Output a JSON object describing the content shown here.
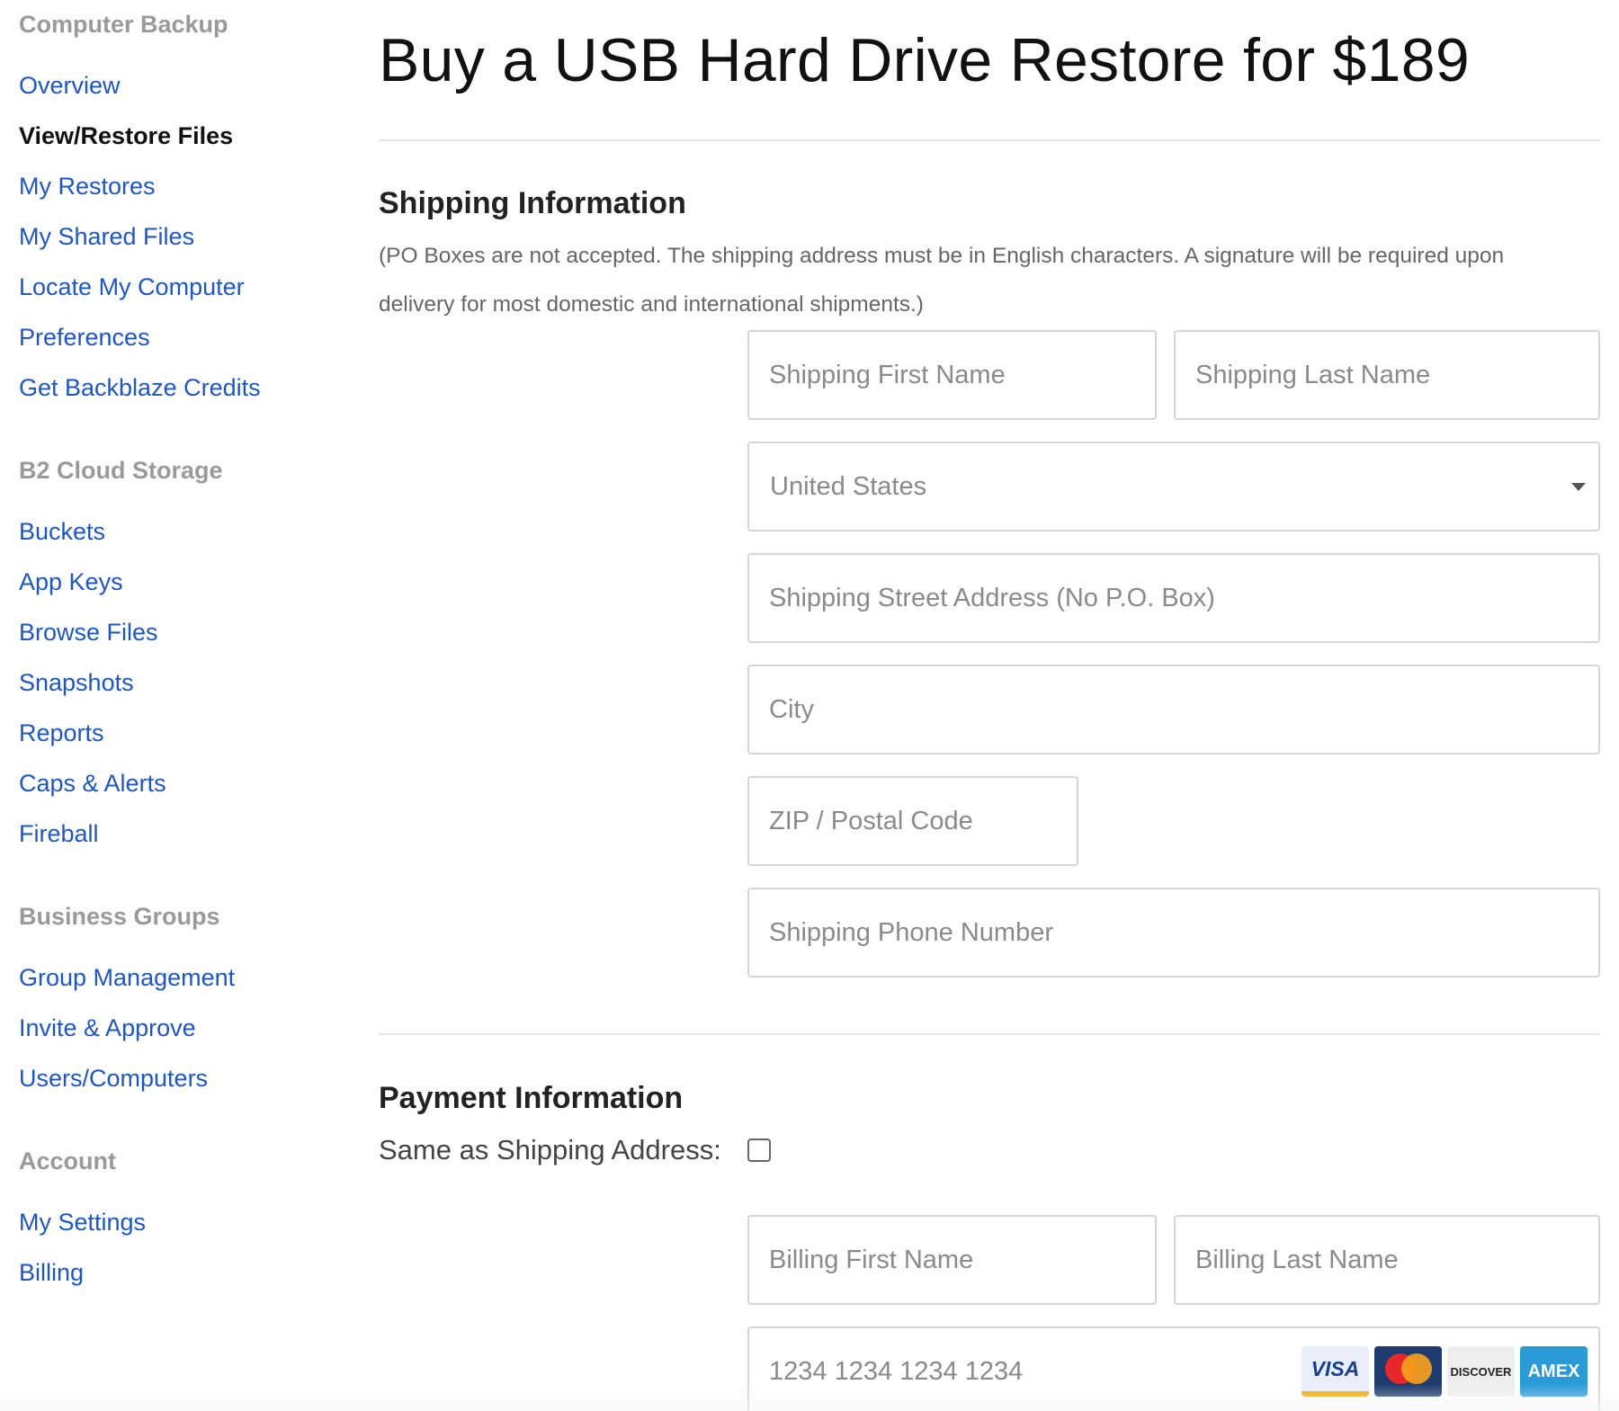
{
  "sidebar": {
    "groups": [
      {
        "heading": "Computer Backup",
        "items": [
          {
            "label": "Overview"
          },
          {
            "label": "View/Restore Files"
          },
          {
            "label": "My Restores"
          },
          {
            "label": "My Shared Files"
          },
          {
            "label": "Locate My Computer"
          },
          {
            "label": "Preferences"
          },
          {
            "label": "Get Backblaze Credits"
          }
        ]
      },
      {
        "heading": "B2 Cloud Storage",
        "items": [
          {
            "label": "Buckets"
          },
          {
            "label": "App Keys"
          },
          {
            "label": "Browse Files"
          },
          {
            "label": "Snapshots"
          },
          {
            "label": "Reports"
          },
          {
            "label": "Caps & Alerts"
          },
          {
            "label": "Fireball"
          }
        ]
      },
      {
        "heading": "Business Groups",
        "items": [
          {
            "label": "Group Management"
          },
          {
            "label": "Invite & Approve"
          },
          {
            "label": "Users/Computers"
          }
        ]
      },
      {
        "heading": "Account",
        "items": [
          {
            "label": "My Settings"
          },
          {
            "label": "Billing"
          }
        ]
      }
    ],
    "active_item": "View/Restore Files"
  },
  "main": {
    "title": "Buy a USB Hard Drive Restore for $189",
    "shipping": {
      "heading": "Shipping Information",
      "note": "(PO Boxes are not accepted. The shipping address must be in English characters. A signature will be required upon delivery for most domestic and international shipments.)",
      "first_name_placeholder": "Shipping First Name",
      "last_name_placeholder": "Shipping Last Name",
      "country_value": "United States",
      "street_placeholder": "Shipping Street Address (No P.O. Box)",
      "city_placeholder": "City",
      "zip_placeholder": "ZIP / Postal Code",
      "phone_placeholder": "Shipping Phone Number"
    },
    "payment": {
      "heading": "Payment Information",
      "same_as_shipping_label": "Same as Shipping Address:",
      "same_as_shipping_checked": false,
      "billing_first_name_placeholder": "Billing First Name",
      "billing_last_name_placeholder": "Billing Last Name",
      "card_number_placeholder": "1234 1234 1234 1234",
      "card_logos": [
        "VISA",
        "MasterCard",
        "DISCOVER",
        "AMEX"
      ]
    }
  },
  "colors": {
    "link": "#1f57c1",
    "heading_gray": "#9a9a9a",
    "border": "#d5d5d5"
  }
}
